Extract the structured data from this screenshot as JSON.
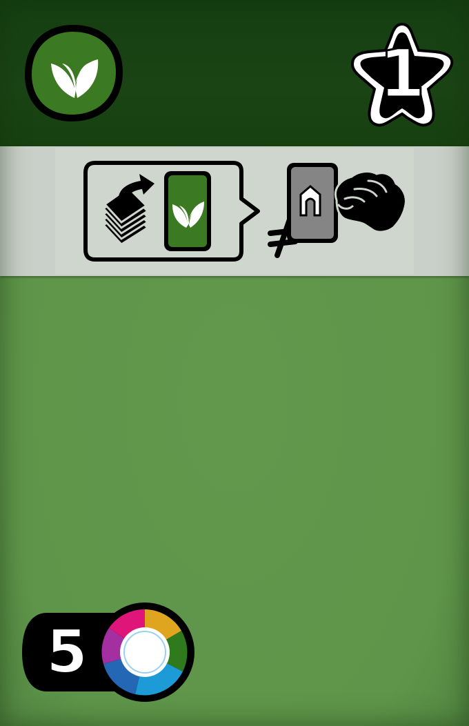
{
  "card": {
    "type_icon": "leaf-icon",
    "points": "1",
    "cost": "5",
    "cost_icon": "any-color-icon",
    "colors": {
      "header": "#1b4415",
      "body": "#5f954a",
      "leaf_badge": "#3b7a22",
      "band": "#c9d0c9"
    }
  },
  "effect": {
    "icons": [
      "deck-draw-icon",
      "leaf-card-icon",
      "not-equal-icon",
      "house-card-icon",
      "grabbing-hand-icon"
    ]
  }
}
